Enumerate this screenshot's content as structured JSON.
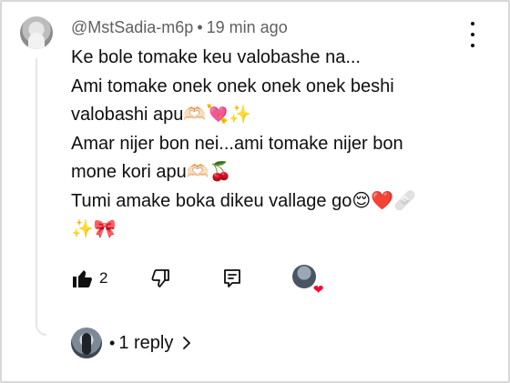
{
  "comment": {
    "author": "@MstSadia-m6p",
    "separator": "•",
    "time": "19 min ago",
    "lines": [
      "Ke bole tomake keu valobashe na...",
      "Ami tomake onek onek onek onek beshi",
      "valobashi apu🫶🏻💘✨",
      "Amar nijer bon nei...ami tomake nijer bon",
      "mone kori apu🫶🏻🍒",
      "Tumi amake boka dikeu vallage go😌❤️🩹",
      "✨🎀"
    ],
    "like_count": "2"
  },
  "icons": {
    "menu": "more-vert-icon",
    "like": "thumb-up-filled-icon",
    "dislike": "thumb-down-outline-icon",
    "reply": "reply-comment-icon",
    "creator_heart": "creator-heart-icon",
    "chevron": "chevron-right-icon"
  },
  "replies": {
    "dot": "•",
    "label": "1 reply"
  },
  "colors": {
    "text": "#0f0f0f",
    "meta": "#606060",
    "heart": "#ff0033",
    "thread_line": "#e5e5e5"
  }
}
